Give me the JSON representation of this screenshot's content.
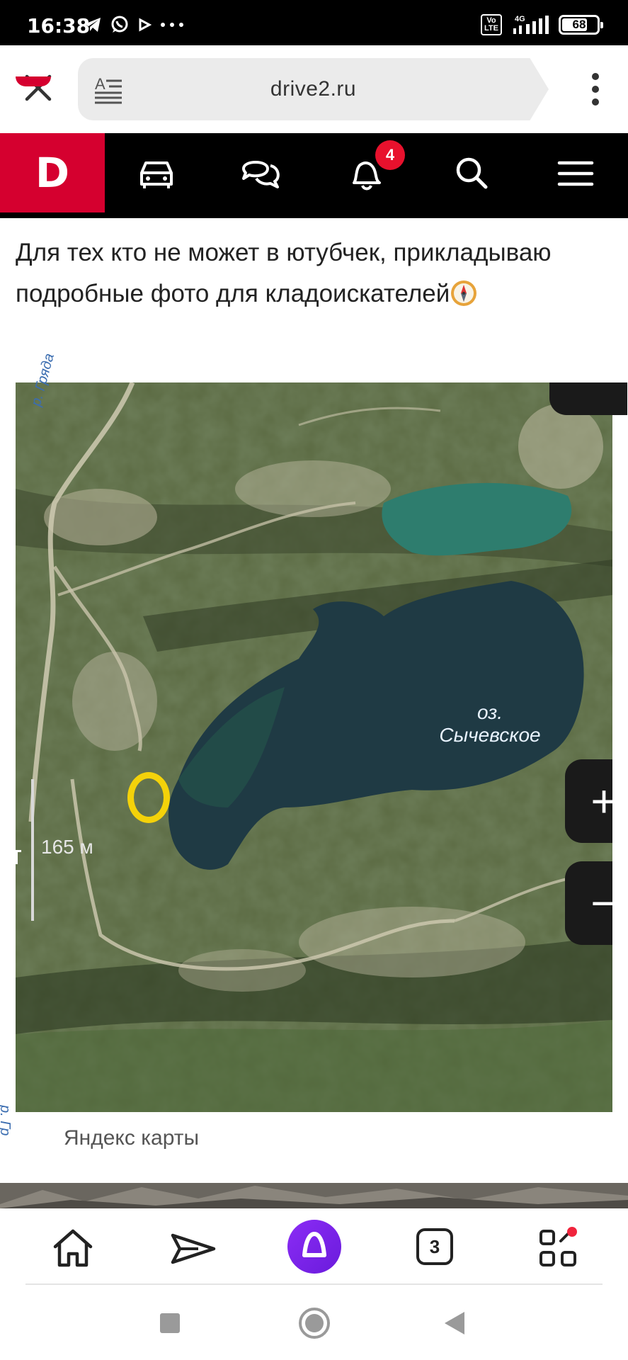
{
  "status_bar": {
    "time": "16:38",
    "network": "4G",
    "volte": "Vo LTE",
    "battery": "68",
    "battery_level": 0.68,
    "icons": [
      "telegram-icon",
      "whatsapp-icon",
      "play-icon",
      "more-dots-icon"
    ]
  },
  "browser": {
    "url": "drive2.ru",
    "reader_icon": "reader-mode-icon",
    "close_icon": "close-icon",
    "menu_icon": "kebab-menu-icon"
  },
  "site_nav": {
    "logo": "D",
    "logo_color": "#d5002f",
    "notification_count": "4",
    "items": [
      "car-icon",
      "chat-icon",
      "bell-icon",
      "search-icon",
      "hamburger-icon"
    ]
  },
  "article": {
    "text": "Для тех кто не может в ютубчек, прикладываю подробные фото для кладоискателей",
    "emoji": "compass-emoji"
  },
  "map": {
    "river_label_top": "р. Гряда",
    "river_label_bottom": "р. Гр",
    "lake_label_line1": "оз.",
    "lake_label_line2": "Сычевское",
    "scale": "165 м",
    "zoom_in": "+",
    "zoom_out": "−",
    "caption": "Яндекс карты"
  },
  "bottom_bar": {
    "tabs_count": "3",
    "accent": "#8b2cf5"
  }
}
